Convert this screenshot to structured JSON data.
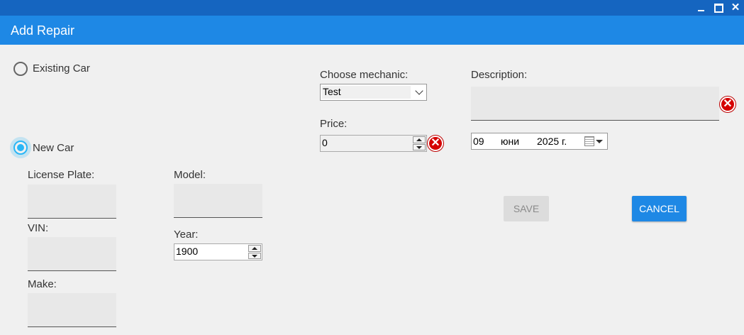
{
  "window": {
    "close_glyph": "✕"
  },
  "header": {
    "title": "Add Repair"
  },
  "car_choice": {
    "existing_label": "Existing Car",
    "new_label": "New Car",
    "selected": "New Car"
  },
  "new_car": {
    "license_plate_label": "License Plate:",
    "license_plate_value": "",
    "vin_label": "VIN:",
    "vin_value": "",
    "make_label": "Make:",
    "make_value": "",
    "model_label": "Model:",
    "model_value": "",
    "year_label": "Year:",
    "year_value": "1900"
  },
  "mechanic": {
    "label": "Choose mechanic:",
    "selected": "Test"
  },
  "price": {
    "label": "Price:",
    "value": "0"
  },
  "description": {
    "label": "Description:",
    "value": ""
  },
  "date": {
    "day": "09",
    "month": "юни",
    "year": "2025 г."
  },
  "error_glyph": "✕",
  "actions": {
    "save_label": "SAVE",
    "cancel_label": "CANCEL"
  },
  "colors": {
    "title_bar": "#1565c0",
    "header": "#1e88e5",
    "accent": "#29b6f6",
    "error": "#d50000"
  }
}
